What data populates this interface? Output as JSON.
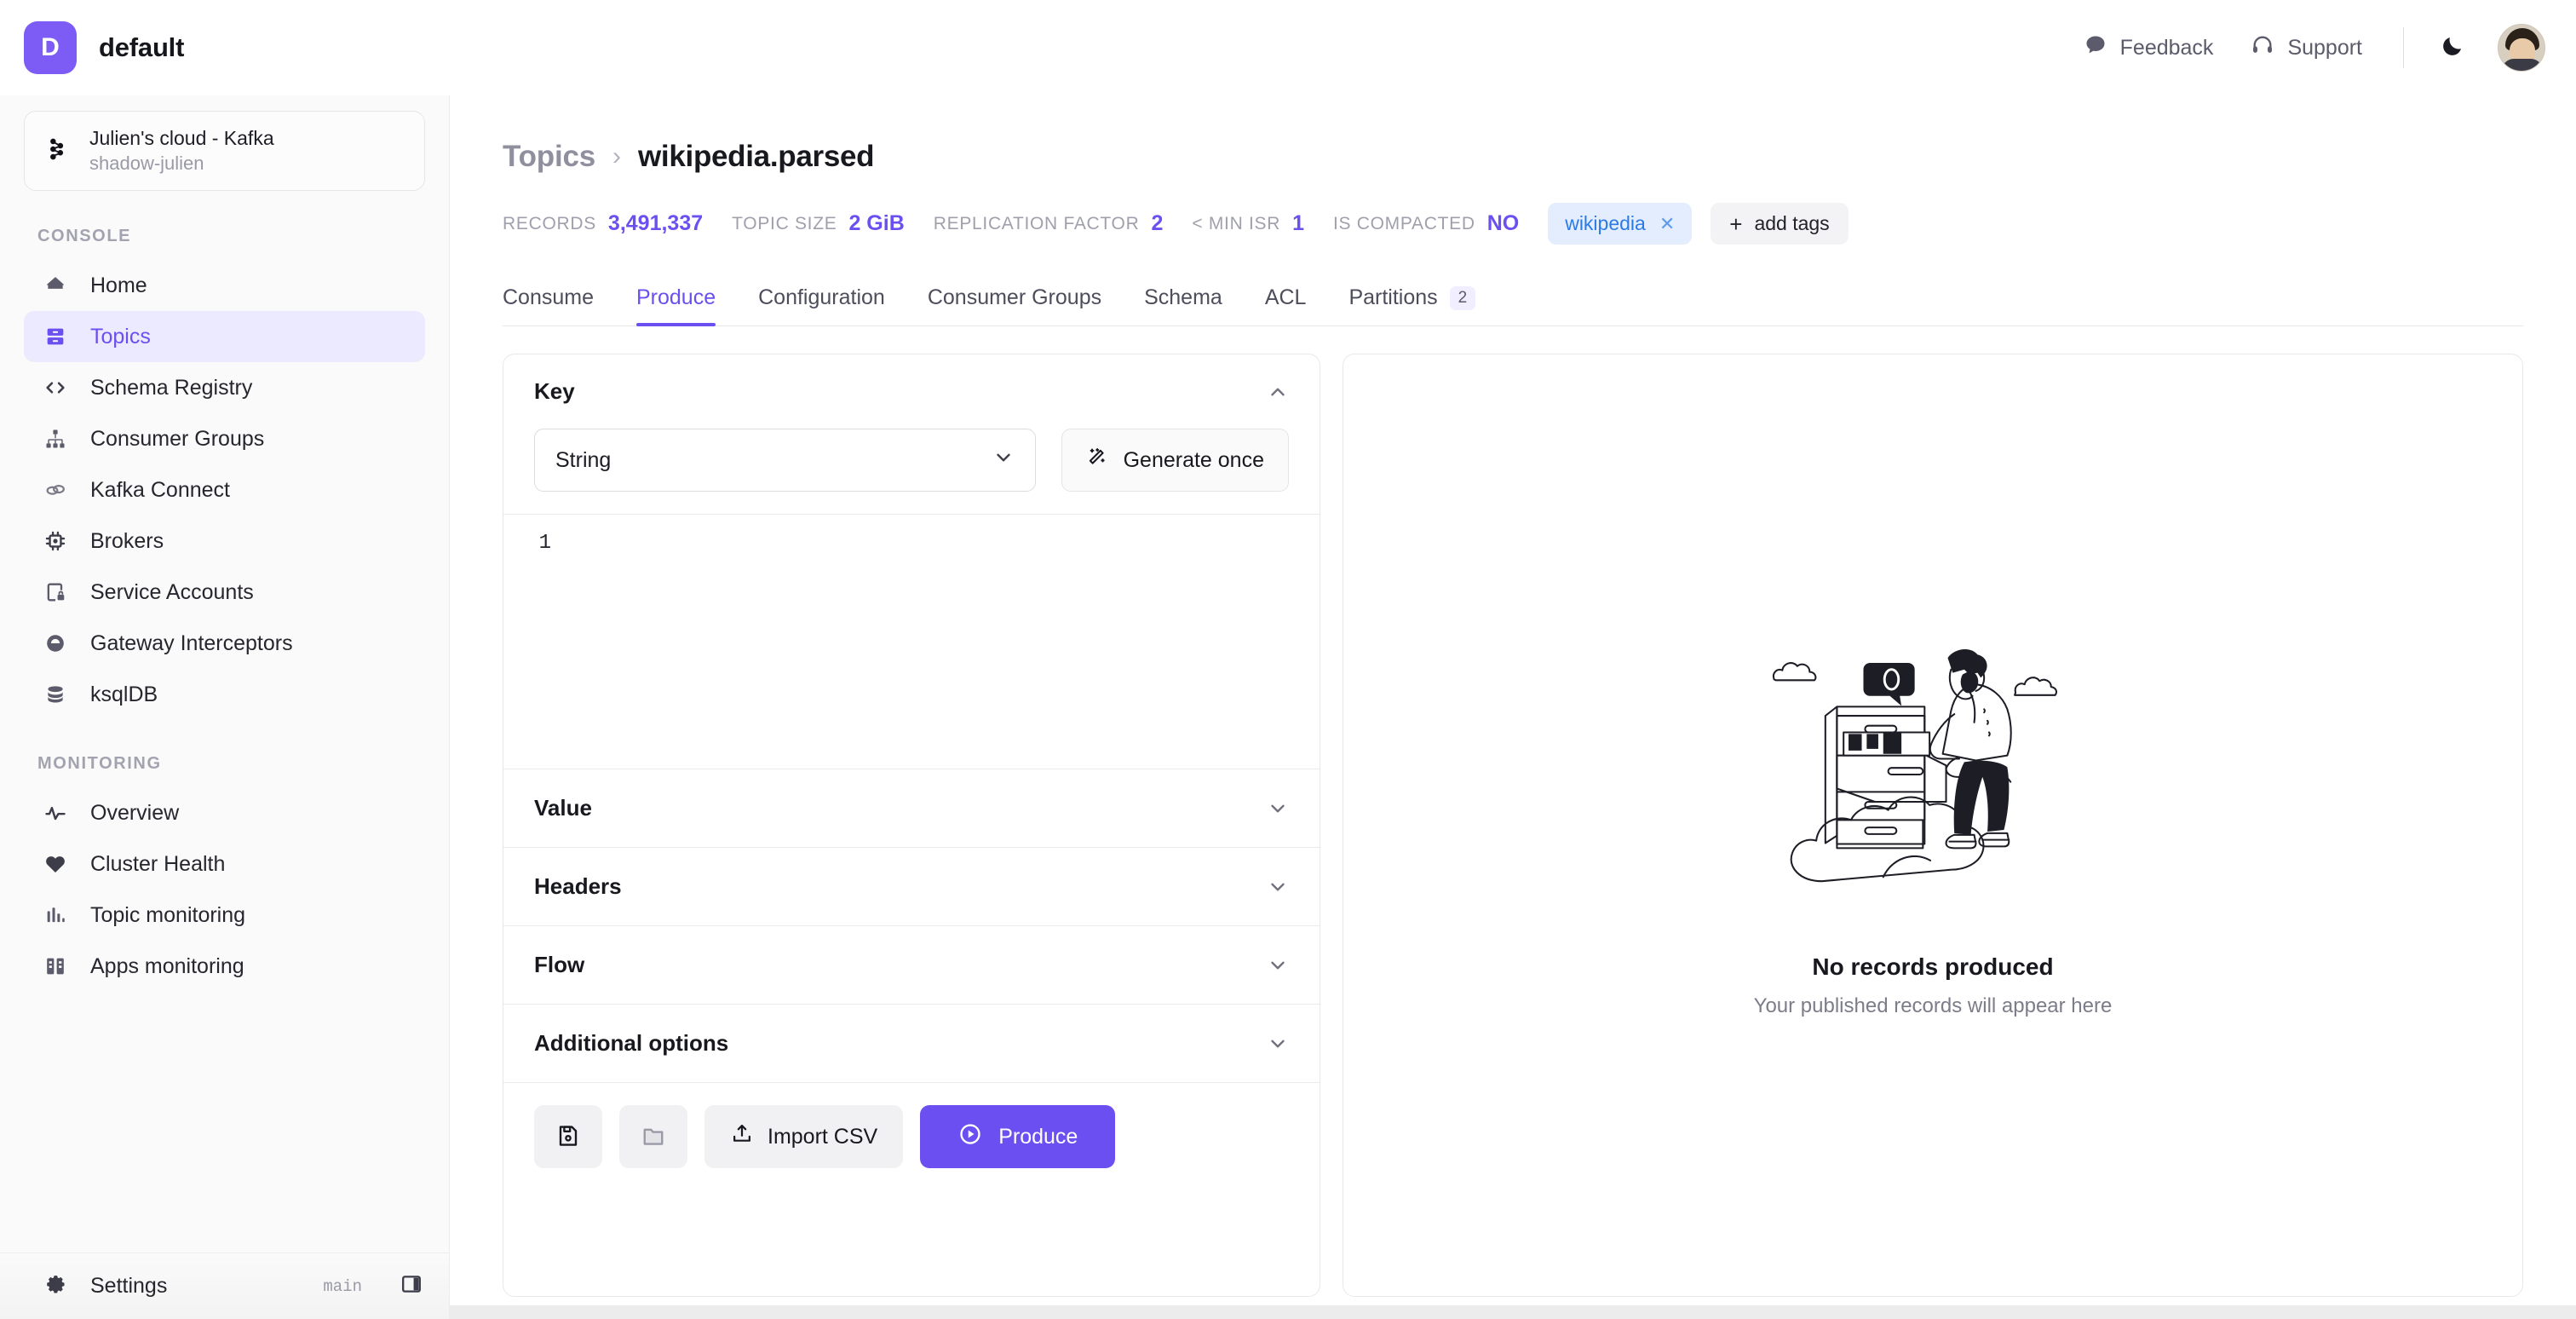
{
  "topbar": {
    "org_initial": "D",
    "org_name": "default",
    "feedback_label": "Feedback",
    "support_label": "Support",
    "theme_icon": "moon-icon",
    "avatar_name": "user-avatar"
  },
  "sidebar": {
    "cluster": {
      "title": "Julien's cloud - Kafka",
      "subtitle": "shadow-julien",
      "icon": "kafka-icon"
    },
    "sections": [
      {
        "label": "CONSOLE",
        "items": [
          {
            "label": "Home",
            "icon": "home-icon",
            "active": false
          },
          {
            "label": "Topics",
            "icon": "topics-icon",
            "active": true
          },
          {
            "label": "Schema Registry",
            "icon": "code-brackets-icon",
            "active": false
          },
          {
            "label": "Consumer Groups",
            "icon": "hierarchy-icon",
            "active": false
          },
          {
            "label": "Kafka Connect",
            "icon": "link-icon",
            "active": false
          },
          {
            "label": "Brokers",
            "icon": "chip-icon",
            "active": false
          },
          {
            "label": "Service Accounts",
            "icon": "account-lock-icon",
            "active": false
          },
          {
            "label": "Gateway Interceptors",
            "icon": "gateway-icon",
            "active": false
          },
          {
            "label": "ksqlDB",
            "icon": "database-icon",
            "active": false
          }
        ]
      },
      {
        "label": "MONITORING",
        "items": [
          {
            "label": "Overview",
            "icon": "pulse-icon",
            "active": false
          },
          {
            "label": "Cluster Health",
            "icon": "heart-icon",
            "active": false
          },
          {
            "label": "Topic monitoring",
            "icon": "bar-chart-icon",
            "active": false
          },
          {
            "label": "Apps monitoring",
            "icon": "apps-icon",
            "active": false
          }
        ]
      }
    ],
    "footer": {
      "settings_label": "Settings",
      "settings_icon": "gear-icon",
      "branch": "main",
      "panel_toggle_icon": "panel-right-icon"
    }
  },
  "page": {
    "breadcrumb_parent": "Topics",
    "breadcrumb_separator": "›",
    "topic_name": "wikipedia.parsed",
    "stats": [
      {
        "label": "RECORDS",
        "value": "3,491,337"
      },
      {
        "label": "TOPIC SIZE",
        "value": "2 GiB"
      },
      {
        "label": "REPLICATION FACTOR",
        "value": "2"
      },
      {
        "label": "< MIN ISR",
        "value": "1"
      },
      {
        "label": "IS COMPACTED",
        "value": "NO"
      }
    ],
    "tags": [
      {
        "label": "wikipedia",
        "remove_icon": "close-icon"
      }
    ],
    "add_tags_label": "add tags",
    "add_tags_plus": "+",
    "tabs": [
      {
        "label": "Consume",
        "active": false,
        "badge": null
      },
      {
        "label": "Produce",
        "active": true,
        "badge": null
      },
      {
        "label": "Configuration",
        "active": false,
        "badge": null
      },
      {
        "label": "Consumer Groups",
        "active": false,
        "badge": null
      },
      {
        "label": "Schema",
        "active": false,
        "badge": null
      },
      {
        "label": "ACL",
        "active": false,
        "badge": null
      },
      {
        "label": "Partitions",
        "active": false,
        "badge": "2"
      }
    ]
  },
  "produce_form": {
    "key_section": {
      "title": "Key",
      "collapse_icon": "chevron-up-icon",
      "format_select": {
        "value": "String",
        "icon": "chevron-down-icon"
      },
      "generate_button": {
        "label": "Generate once",
        "icon": "magic-wand-icon"
      },
      "editor": {
        "line_number": "1",
        "content": ""
      }
    },
    "collapsed_sections": [
      {
        "title": "Value",
        "icon": "chevron-down-icon"
      },
      {
        "title": "Headers",
        "icon": "chevron-down-icon"
      },
      {
        "title": "Flow",
        "icon": "chevron-down-icon"
      },
      {
        "title": "Additional options",
        "icon": "chevron-down-icon"
      }
    ],
    "actions": {
      "save_icon": "floppy-disk-icon",
      "open_icon": "folder-icon",
      "import_csv_label": "Import CSV",
      "import_csv_icon": "upload-icon",
      "produce_label": "Produce",
      "produce_icon": "play-circle-icon"
    }
  },
  "result_panel": {
    "illustration": "person-filing-cabinet-cloud-illustration",
    "bubble_text": "0",
    "empty_title": "No records produced",
    "empty_subtitle": "Your published records will appear here"
  },
  "colors": {
    "accent": "#6c4ff0",
    "accent_soft": "#eceaff",
    "tag_bg": "#e3edfd",
    "tag_text": "#2c7be5",
    "sidebar_bg": "#fafafa",
    "text_primary": "#18181f",
    "text_muted": "#8f8f9e"
  }
}
